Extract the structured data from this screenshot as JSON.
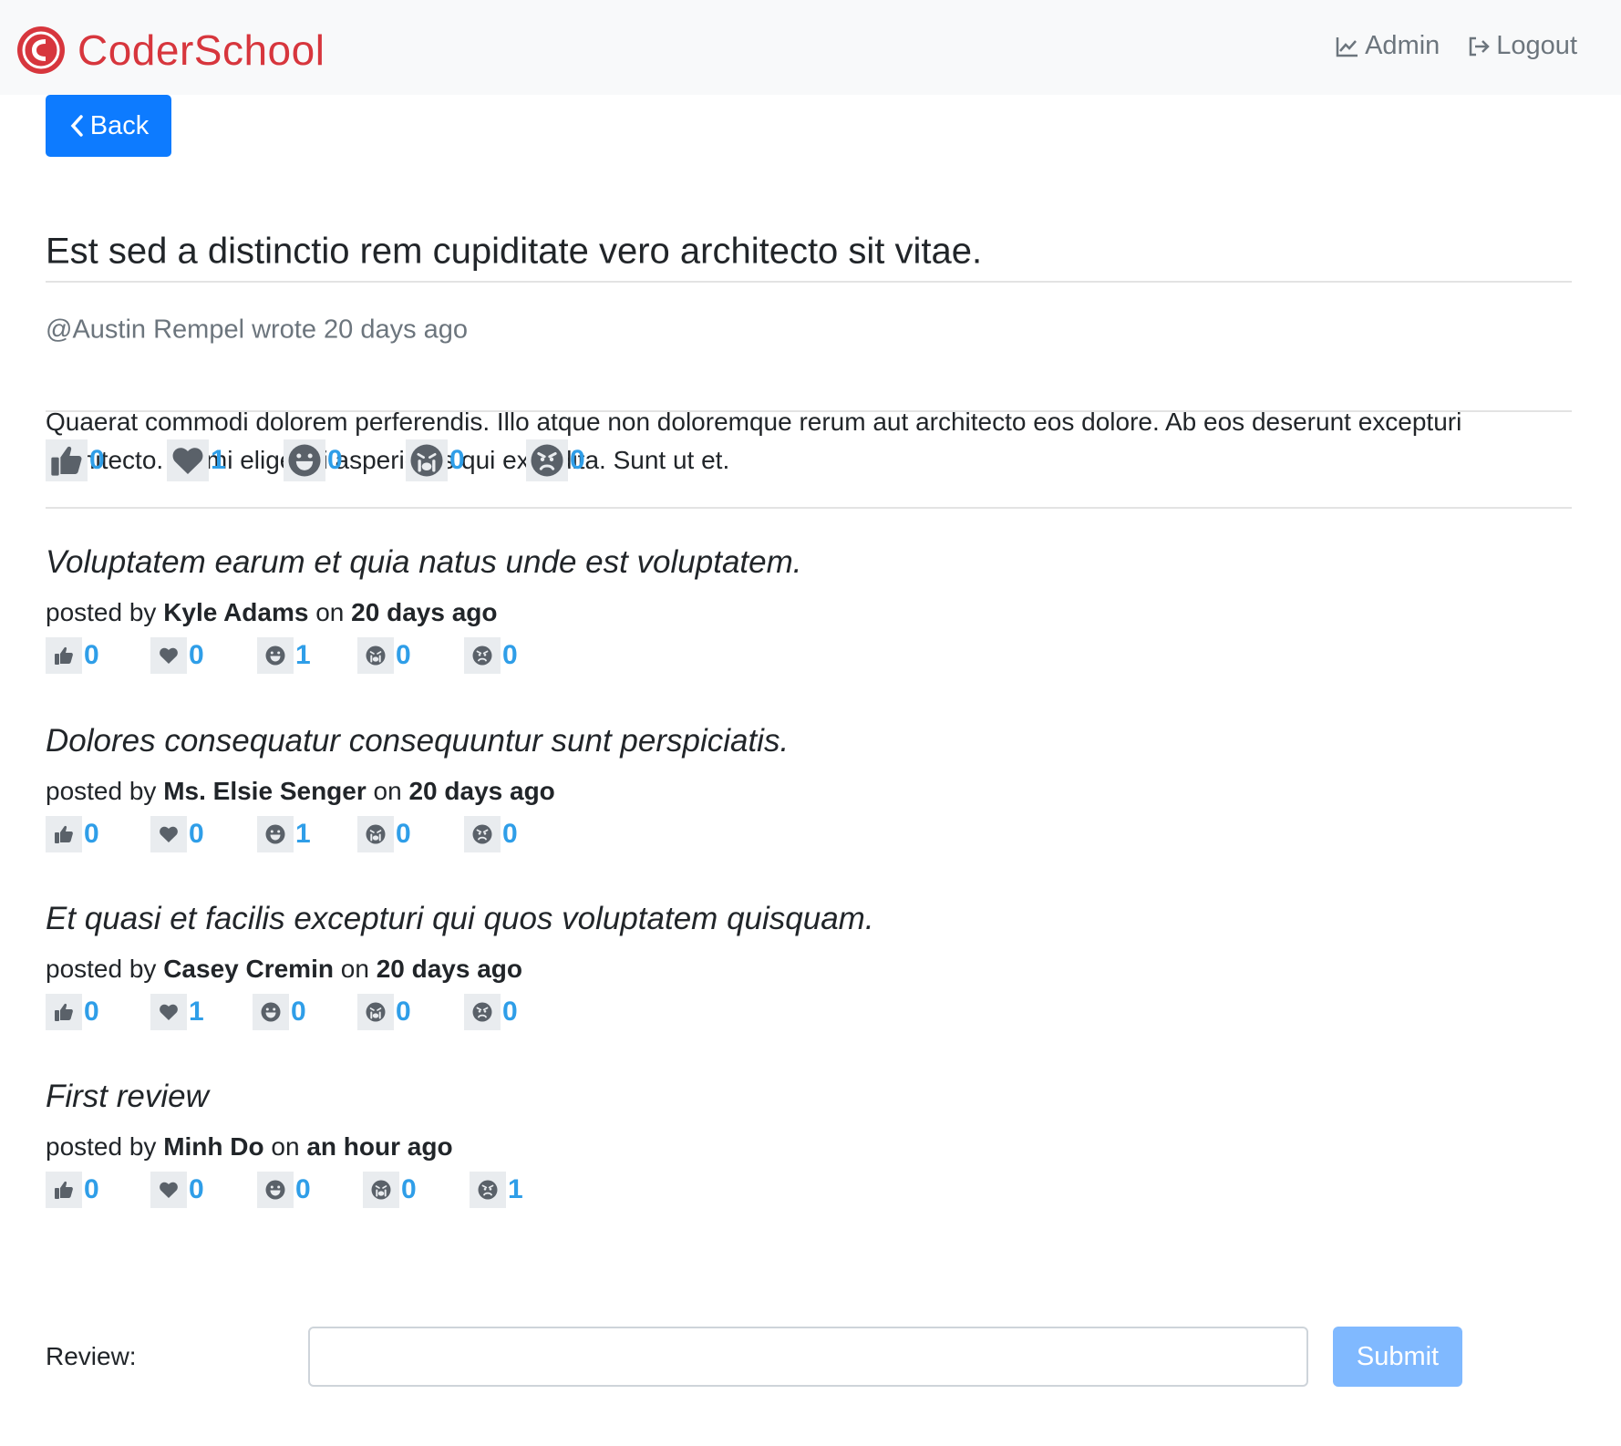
{
  "navbar": {
    "brand": "CoderSchool",
    "links": [
      {
        "label": "Admin",
        "icon": "chart-line-icon"
      },
      {
        "label": "Logout",
        "icon": "sign-out-icon"
      }
    ]
  },
  "back_label": "Back",
  "post": {
    "title": "Est sed a distinctio rem cupiditate vero architecto sit vitae.",
    "meta": "@Austin Rempel wrote 20 days ago",
    "body": "Quaerat commodi dolorem perferendis. Illo atque non doloremque rerum aut architecto eos dolore. Ab eos deserunt excepturi architecto. Animi eligendi asperiores qui expedita. Sunt ut et.",
    "reactions": {
      "like": "0",
      "love": "1",
      "laugh": "0",
      "cry": "0",
      "angry": "0"
    }
  },
  "review_meta_words": {
    "posted_by": "posted by",
    "on": "on"
  },
  "reviews": [
    {
      "title": "Voluptatem earum et quia natus unde est voluptatem.",
      "author": "Kyle Adams",
      "time": "20 days ago",
      "reactions": {
        "like": "0",
        "love": "0",
        "laugh": "1",
        "cry": "0",
        "angry": "0"
      }
    },
    {
      "title": "Dolores consequatur consequuntur sunt perspiciatis.",
      "author": "Ms. Elsie Senger",
      "time": "20 days ago",
      "reactions": {
        "like": "0",
        "love": "0",
        "laugh": "1",
        "cry": "0",
        "angry": "0"
      }
    },
    {
      "title": "Et quasi et facilis excepturi qui quos voluptatem quisquam.",
      "author": "Casey Cremin",
      "time": "20 days ago",
      "reactions": {
        "like": "0",
        "love": "1",
        "laugh": "0",
        "cry": "0",
        "angry": "0"
      }
    },
    {
      "title": "First review",
      "author": "Minh Do",
      "time": "an hour ago",
      "reactions": {
        "like": "0",
        "love": "0",
        "laugh": "0",
        "cry": "0",
        "angry": "1"
      }
    }
  ],
  "form": {
    "label": "Review:",
    "input_value": "",
    "submit_label": "Submit"
  },
  "colors": {
    "brand": "#d7363d",
    "primary": "#0d7bff",
    "submit_disabled": "#80b9ff",
    "reaction_count": "#2f9ee8",
    "muted": "#6c757d"
  }
}
